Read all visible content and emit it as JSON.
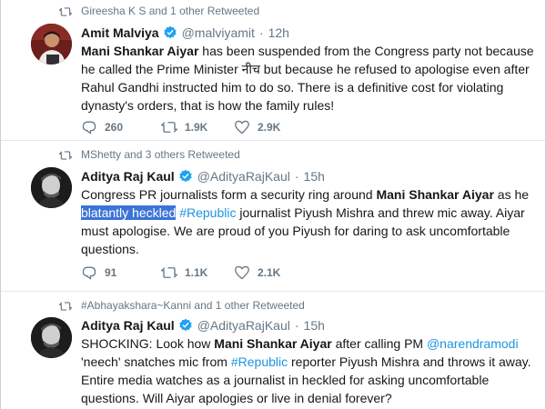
{
  "tweets": [
    {
      "retweet_note": "Gireesha K S and 1 other Retweeted",
      "name": "Amit Malviya",
      "handle": "@malviyamit",
      "time": "12h",
      "text": {
        "b1": "Mani Shankar Aiyar",
        "p1": " has been suspended from the Congress party not because he called the Prime Minister नीच but because he refused to apologise even after Rahul Gandhi instructed him to do so. There is a definitive cost for violating dynasty's orders, that is how the family rules!"
      },
      "replies": "260",
      "retweets": "1.9K",
      "likes": "2.9K"
    },
    {
      "retweet_note": "MShetty and 3 others Retweeted",
      "name": "Aditya Raj Kaul",
      "handle": "@AdityaRajKaul",
      "time": "15h",
      "text": {
        "p1": "Congress PR journalists form a security ring around ",
        "b1": "Mani Shankar Aiyar",
        "p2": " as he ",
        "hl": "blatantly heckled",
        "sp": " ",
        "tag": "#Republic",
        "p3": " journalist Piyush Mishra and threw mic away. Aiyar must apologise. We are proud of you Piyush for daring to ask uncomfortable questions."
      },
      "replies": "91",
      "retweets": "1.1K",
      "likes": "2.1K"
    },
    {
      "retweet_note": "#Abhayakshara~Kanni and 1 other Retweeted",
      "name": "Aditya Raj Kaul",
      "handle": "@AdityaRajKaul",
      "time": "15h",
      "text": {
        "p1": "SHOCKING: Look how ",
        "b1": "Mani Shankar Aiyar",
        "p2": " after calling PM ",
        "mention": "@narendramodi",
        "p3": " 'neech' snatches mic from ",
        "tag": "#Republic",
        "p4": " reporter Piyush Mishra and throws it away. Entire media watches as a journalist in heckled for asking uncomfortable questions. Will Aiyar apologies or live in denial forever?"
      }
    }
  ],
  "dot": "·",
  "colors": {
    "link": "#1b95e0",
    "verified": "#1da1f2",
    "muted": "#657786",
    "highlight": "#3b74d6"
  },
  "icons": [
    "retweet-icon",
    "reply-icon",
    "like-icon",
    "verified-icon"
  ]
}
